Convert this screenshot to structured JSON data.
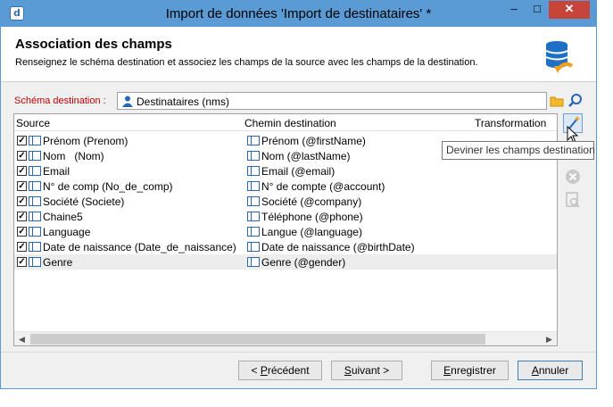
{
  "window": {
    "title": "Import de données 'Import de destinataires' *",
    "app_icon": "d",
    "controls": {
      "minimize": "–",
      "maximize": "□",
      "close": "✕"
    }
  },
  "header": {
    "title": "Association des champs",
    "subtitle": "Renseignez le schéma destination et associez les champs de la source avec les champs de la destination.",
    "icon": "database-arrow-icon"
  },
  "schema": {
    "label": "Schéma destination :",
    "value": "Destinataires (nms)",
    "icons": [
      "person-icon",
      "folder-icon",
      "search-icon"
    ]
  },
  "grid": {
    "columns": [
      "Source",
      "Chemin destination",
      "Transformation"
    ],
    "rows": [
      {
        "checked": true,
        "source": "Prénom (Prenom)",
        "destination": "Prénom (@firstName)"
      },
      {
        "checked": true,
        "source": "Nom   (Nom)",
        "destination": "Nom (@lastName)"
      },
      {
        "checked": true,
        "source": "Email",
        "destination": "Email (@email)"
      },
      {
        "checked": true,
        "source": "N° de comp (No_de_comp)",
        "destination": "N° de compte (@account)"
      },
      {
        "checked": true,
        "source": "Société (Societe)",
        "destination": "Société (@company)"
      },
      {
        "checked": true,
        "source": "Chaine5",
        "destination": "Téléphone (@phone)"
      },
      {
        "checked": true,
        "source": "Language",
        "destination": "Langue (@language)"
      },
      {
        "checked": true,
        "source": "Date de naissance (Date_de_naissance)",
        "destination": "Date de naissance (@birthDate)"
      },
      {
        "checked": true,
        "source": "Genre",
        "destination": "Genre (@gender)",
        "selected": true
      }
    ],
    "scroll_left": "◀",
    "scroll_right": "▶"
  },
  "side_buttons": [
    "wand-icon",
    "delete-icon",
    "preview-icon"
  ],
  "tooltip": "Deviner les champs destination",
  "footer": {
    "prev": {
      "key": "P",
      "rest": "récédent",
      "prefix": "< "
    },
    "next": {
      "key": "S",
      "rest": "uivant",
      "suffix": " >"
    },
    "save": {
      "key": "E",
      "rest": "nregistrer"
    },
    "cancel": {
      "key": "A",
      "rest": "nnuler"
    }
  },
  "colors": {
    "titlebar": "#5a9ad5",
    "close": "#c7443a",
    "schema_label": "#c00000",
    "field_icon": "#2a64b5"
  }
}
